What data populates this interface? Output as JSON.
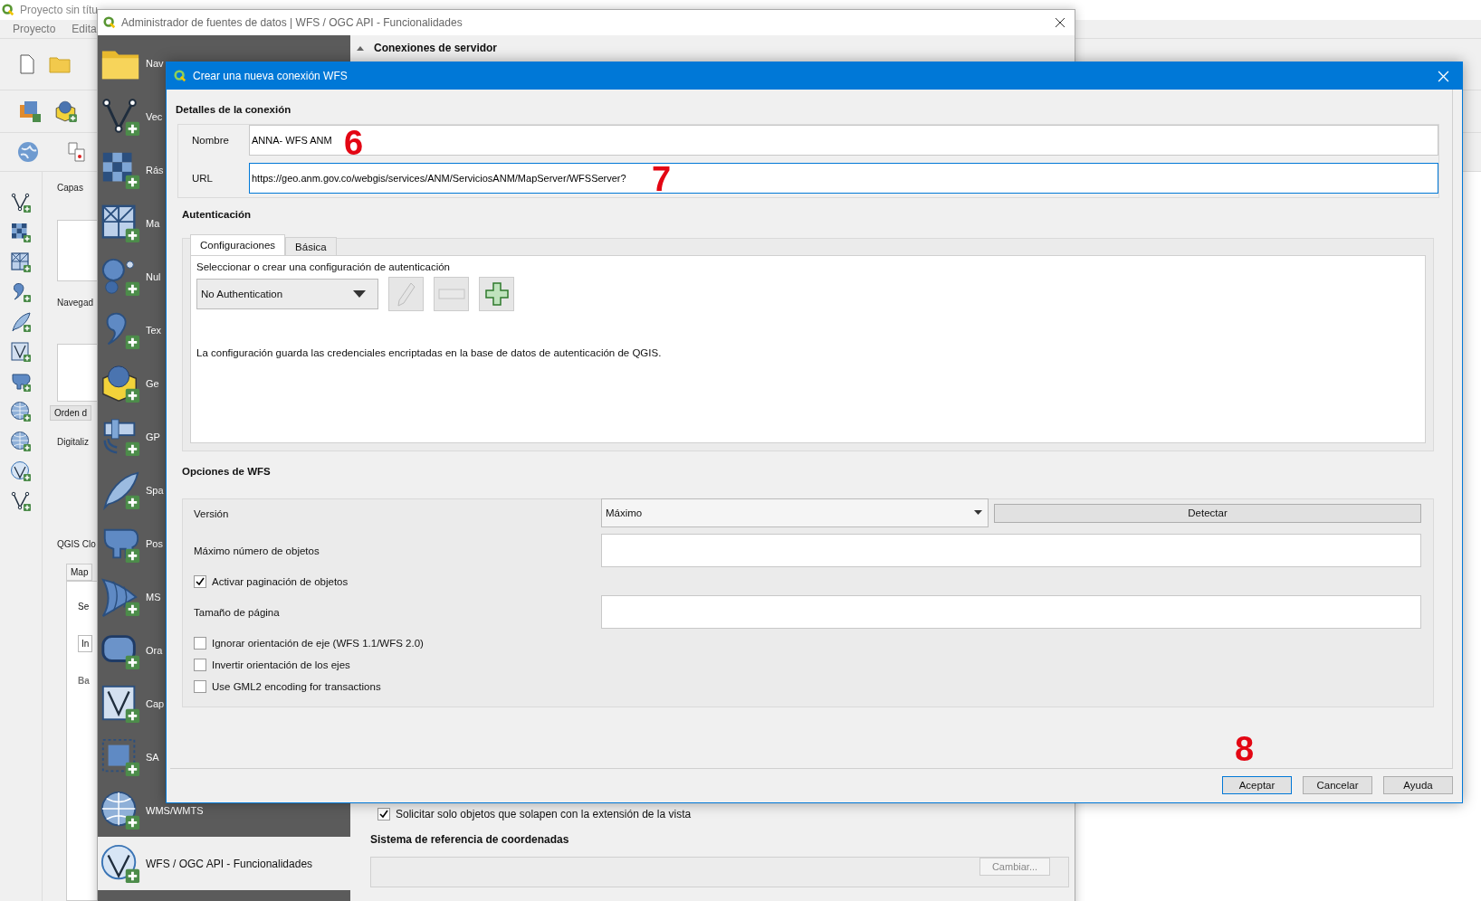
{
  "main_window": {
    "title": "Proyecto sin títu",
    "menu": [
      "Proyecto",
      "Edita"
    ],
    "layers_panel": "Capas",
    "browser_panel": "Navegad",
    "order_tab": "Orden d",
    "digitizing_panel": "Digitaliz",
    "cloud_panel": "QGIS Clo",
    "cloud_tab": "Map",
    "cloud_label": "Se",
    "cloud_field": "In",
    "cloud_section": "Ba"
  },
  "data_source_manager": {
    "title": "Administrador de fuentes de datos | WFS / OGC API - Funcionalidades",
    "sidebar": [
      {
        "label": "Nav",
        "selected": false
      },
      {
        "label": "Vec",
        "selected": false
      },
      {
        "label": "Rás",
        "selected": false
      },
      {
        "label": "Ma",
        "selected": false
      },
      {
        "label": "Nul",
        "selected": false
      },
      {
        "label": "Tex",
        "selected": false
      },
      {
        "label": "Ge",
        "selected": false
      },
      {
        "label": "GP",
        "selected": false
      },
      {
        "label": "Spa",
        "selected": false
      },
      {
        "label": "Pos",
        "selected": false
      },
      {
        "label": "MS",
        "selected": false
      },
      {
        "label": "Ora",
        "selected": false
      },
      {
        "label": "Cap",
        "selected": false
      },
      {
        "label": "SA",
        "selected": false
      },
      {
        "label": "WMS/WMTS",
        "selected": false
      },
      {
        "label": "WFS / OGC API - Funcionalidades",
        "selected": true
      }
    ],
    "section": "Conexiones de servidor",
    "overlap_checkbox": {
      "label": "Solicitar solo objetos que solapen con la extensión de la vista",
      "checked": true
    },
    "crs_title": "Sistema de referencia de coordenadas",
    "change_button": "Cambiar..."
  },
  "wfs_dialog": {
    "title": "Crear una nueva conexión WFS",
    "connection_section": "Detalles de la conexión",
    "name": {
      "label": "Nombre",
      "value": "ANNA- WFS ANM"
    },
    "url": {
      "label": "URL",
      "value": "https://geo.anm.gov.co/webgis/services/ANM/ServiciosANM/MapServer/WFSServer?"
    },
    "auth_section": "Autenticación",
    "auth_tabs": [
      {
        "label": "Configuraciones",
        "selected": true
      },
      {
        "label": "Básica",
        "selected": false
      }
    ],
    "auth_prompt": "Seleccionar o crear una configuración de autenticación",
    "auth_config": "No Authentication",
    "auth_note": "La configuración guarda las credenciales encriptadas en la base de datos de autenticación de QGIS.",
    "options_section": "Opciones de WFS",
    "options": [
      {
        "kind": "combo",
        "label": "Versión",
        "value": "Máximo",
        "button": "Detectar"
      },
      {
        "kind": "field",
        "label": "Máximo número de objetos"
      },
      {
        "kind": "checkbox",
        "label": "Activar paginación de objetos",
        "checked": true
      },
      {
        "kind": "field",
        "label": "Tamaño de página"
      },
      {
        "kind": "checkbox",
        "label": "Ignorar orientación de eje (WFS 1.1/WFS 2.0)",
        "checked": false
      },
      {
        "kind": "checkbox",
        "label": "Invertir orientación de los ejes",
        "checked": false
      },
      {
        "kind": "checkbox",
        "label": "Use GML2 encoding for transactions",
        "checked": false
      }
    ],
    "buttons": [
      {
        "label": "Aceptar",
        "default": true
      },
      {
        "label": "Cancelar",
        "default": false
      },
      {
        "label": "Ayuda",
        "default": false
      }
    ],
    "annotations": [
      "6",
      "7",
      "8"
    ]
  }
}
